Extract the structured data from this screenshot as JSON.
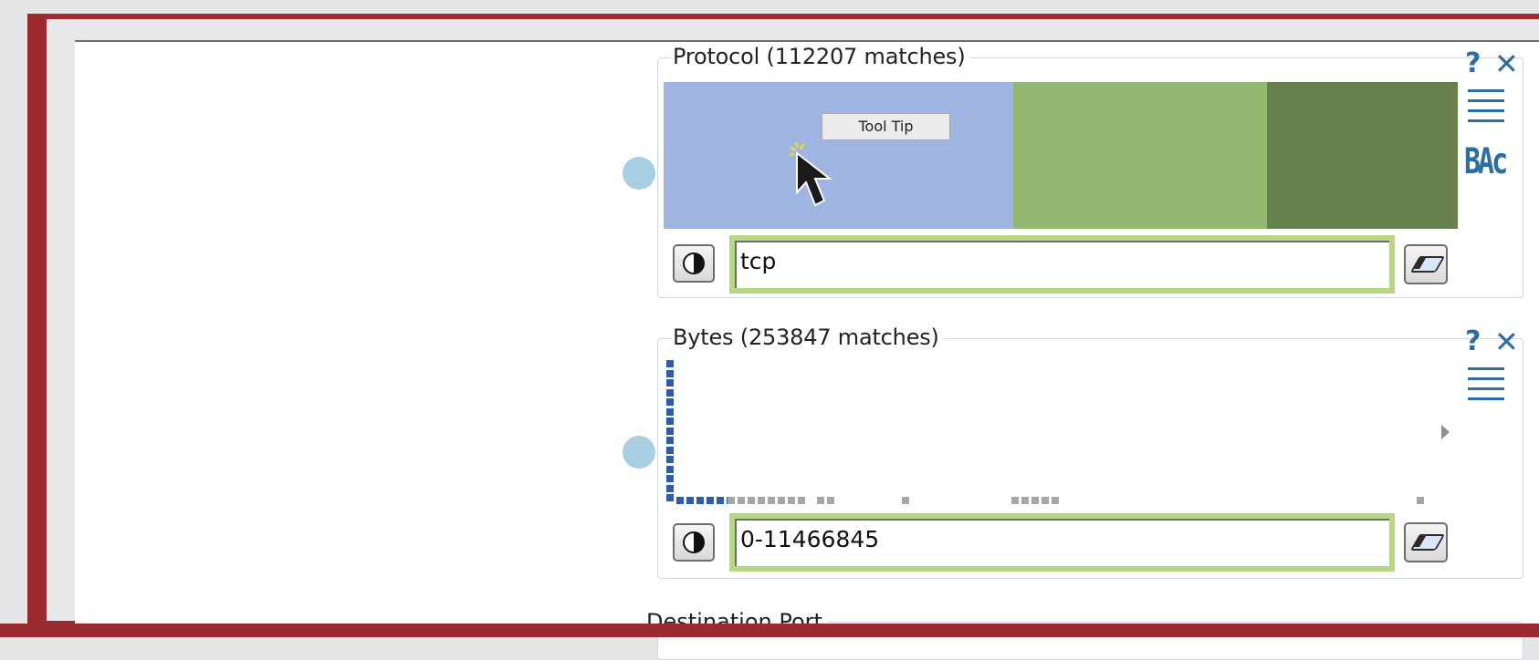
{
  "protocol_widget": {
    "title": "Protocol (112207 matches)",
    "help_label": "?",
    "close_label": "✕",
    "menu_icon": "hamburger-menu-icon",
    "sort_icon": "BAc",
    "segments": [
      {
        "color": "#9db5e0",
        "share": 0.44
      },
      {
        "color": "#94b771",
        "share": 0.32
      },
      {
        "color": "#66814b",
        "share": 0.24
      }
    ],
    "filter_value": "tcp",
    "tooltip": "Tool Tip"
  },
  "bytes_widget": {
    "title": "Bytes (253847 matches)",
    "help_label": "?",
    "close_label": "✕",
    "menu_icon": "hamburger-menu-icon",
    "filter_value": "0-11466845"
  },
  "destination_port_widget": {
    "title": "Destination Port"
  },
  "colors": {
    "frame": "#9b2b31",
    "accent": "#2e6da4",
    "input_border": "#b6d882",
    "connector": "#a8cfe1",
    "hist_selected": "#2d5da8",
    "hist_unselected": "#a6a6a6"
  }
}
